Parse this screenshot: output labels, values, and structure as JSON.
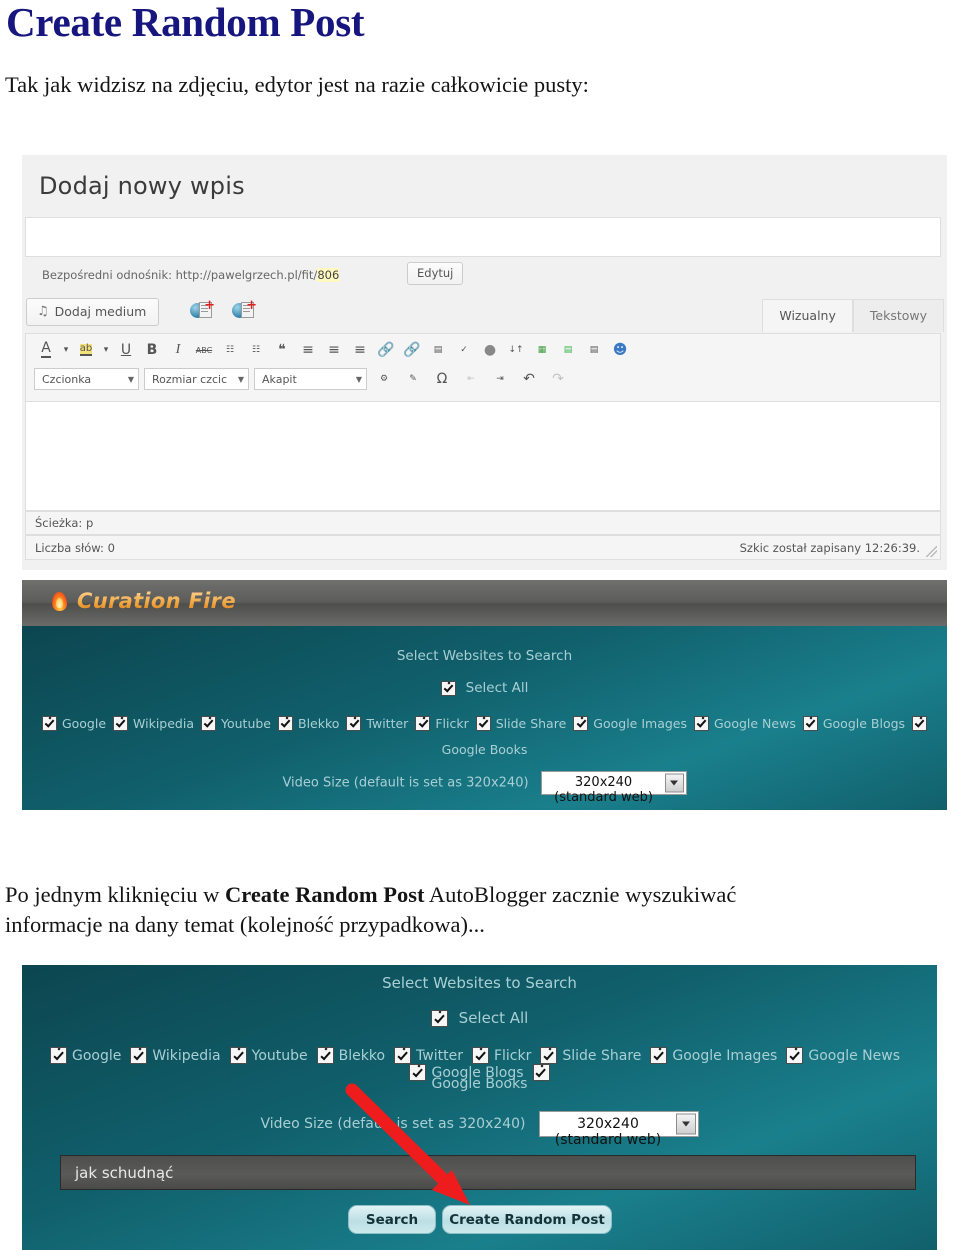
{
  "document": {
    "title": "Create Random Post",
    "paragraph1": "Tak jak widzisz na zdjęciu, edytor jest na razie całkowicie pusty:",
    "paragraph2_pre": "Po jednym kliknięciu w ",
    "paragraph2_bold": "Create Random Post",
    "paragraph2_post": " AutoBlogger zacznie wyszukiwać informacje na dany temat (kolejność przypadkowa)...",
    "title_color": "#16167e"
  },
  "wp_editor": {
    "heading": "Dodaj nowy wpis",
    "title_field_value": "",
    "permalink_prefix": "Bezpośredni odnośnik: http://pawelgrzech.pl/fit/",
    "permalink_id": "806",
    "edit_button": "Edytuj",
    "add_media_button": "Dodaj medium",
    "add_media_icon": "photo-music-icon",
    "media_icon_1": "add-video-globe-icon",
    "media_icon_2": "add-article-globe-icon",
    "tabs": [
      {
        "label": "Wizualny",
        "active": true
      },
      {
        "label": "Tekstowy",
        "active": false
      }
    ],
    "toolbar_row1": [
      {
        "icon": "text-color-icon",
        "glyph": "A"
      },
      {
        "icon": "text-color-dropdown-icon",
        "glyph": "▾"
      },
      {
        "icon": "highlight-color-icon",
        "glyph": "ab"
      },
      {
        "icon": "highlight-color-dropdown-icon",
        "glyph": "▾"
      },
      {
        "icon": "underline-icon",
        "glyph": "U"
      },
      {
        "icon": "bold-icon",
        "glyph": "B"
      },
      {
        "icon": "italic-icon",
        "glyph": "I"
      },
      {
        "icon": "strikethrough-icon",
        "glyph": "ABC"
      },
      {
        "icon": "bullet-list-icon",
        "glyph": "☰"
      },
      {
        "icon": "numbered-list-icon",
        "glyph": "☰"
      },
      {
        "icon": "blockquote-icon",
        "glyph": "❝"
      },
      {
        "icon": "align-left-icon",
        "glyph": "≡"
      },
      {
        "icon": "align-center-icon",
        "glyph": "≡"
      },
      {
        "icon": "align-right-icon",
        "glyph": "≡"
      },
      {
        "icon": "insert-link-icon",
        "glyph": "🔗"
      },
      {
        "icon": "unlink-icon",
        "glyph": "🔗"
      },
      {
        "icon": "read-more-icon",
        "glyph": "▤"
      },
      {
        "icon": "spellcheck-icon",
        "glyph": "✓"
      },
      {
        "icon": "help-icon",
        "glyph": "?"
      },
      {
        "icon": "fullscreen-icon",
        "glyph": "↕"
      },
      {
        "icon": "color-blocks-icon",
        "glyph": "▦"
      },
      {
        "icon": "green-bars-icon",
        "glyph": "▤"
      },
      {
        "icon": "lines-box-icon",
        "glyph": "▤"
      },
      {
        "icon": "user-avatar-icon",
        "glyph": "☻"
      }
    ],
    "toolbar_selects": [
      {
        "label": "Czcionka"
      },
      {
        "label": "Rozmiar czcic"
      },
      {
        "label": "Akapit"
      }
    ],
    "toolbar_row2": [
      {
        "icon": "remove-format-icon",
        "glyph": "🗑"
      },
      {
        "icon": "eraser-icon",
        "glyph": "✎"
      },
      {
        "icon": "special-character-icon",
        "glyph": "Ω"
      },
      {
        "icon": "outdent-icon",
        "glyph": "⇤"
      },
      {
        "icon": "indent-icon",
        "glyph": "⇥"
      },
      {
        "icon": "undo-icon",
        "glyph": "↰"
      },
      {
        "icon": "redo-icon",
        "glyph": "↱"
      }
    ],
    "path_status": "Ścieżka: p",
    "word_count": "Liczba słów: 0",
    "draft_saved": "Szkic został zapisany 12:26:39."
  },
  "curation_fire": {
    "brand": "Curation Fire",
    "brand_icon": "flame-icon",
    "websites_heading": "Select Websites to Search",
    "select_all_label": "Select All",
    "select_all_checked": true,
    "sites": [
      {
        "label": "Google",
        "checked": true
      },
      {
        "label": "Wikipedia",
        "checked": true
      },
      {
        "label": "Youtube",
        "checked": true
      },
      {
        "label": "Blekko",
        "checked": true
      },
      {
        "label": "Twitter",
        "checked": true
      },
      {
        "label": "Flickr",
        "checked": true
      },
      {
        "label": "Slide Share",
        "checked": true
      },
      {
        "label": "Google Images",
        "checked": true
      },
      {
        "label": "Google News",
        "checked": true
      },
      {
        "label": "Google Blogs",
        "checked": true
      }
    ],
    "last_site": {
      "label": "Google Books",
      "checked": true
    },
    "video_size_label": "Video Size (default is set as 320x240)",
    "video_size_value": "320x240 (standard web)",
    "search_input_value": "jak schudnąć",
    "search_button": "Search",
    "create_random_post_button": "Create Random Post",
    "arrow_color": "#ee1c1c",
    "panel_bg_teal": "#10606c",
    "header_bg_gray": "#5c5c5a"
  }
}
